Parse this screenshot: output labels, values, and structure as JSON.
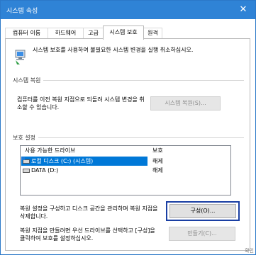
{
  "window": {
    "title": "시스템 속성",
    "close_glyph": "✕"
  },
  "tabs": [
    {
      "label": "컴퓨터 이름",
      "active": false
    },
    {
      "label": "하드웨어",
      "active": false
    },
    {
      "label": "고급",
      "active": false
    },
    {
      "label": "시스템 보호",
      "active": true
    },
    {
      "label": "원격",
      "active": false
    }
  ],
  "intro": {
    "icon": "system-protection-shield-icon",
    "text": "시스템 보호를 사용하여 불필요한 시스템 변경을 실행 취소하십시오."
  },
  "restore": {
    "section_label": "시스템 복원",
    "description": "컴퓨터를 이전 복원 지점으로 되돌려 시스템 변경을 취소할 수 있습니다.",
    "button_label": "시스템 복원(S)..."
  },
  "protection": {
    "section_label": "보호 설정",
    "columns": [
      "사용 가능한 드라이브",
      "보호"
    ],
    "drives": [
      {
        "name": "로컬 디스크 (C:) (시스템)",
        "protection": "해제",
        "selected": true,
        "icon": "system-drive-icon"
      },
      {
        "name": "DATA (D:)",
        "protection": "해제",
        "selected": false,
        "icon": "drive-icon"
      }
    ],
    "configure_text": "복원 설정을 구성하고 디스크 공간을 관리하며 복원 지점을 삭제합니다.",
    "configure_button": "구성(O)...",
    "create_text": "복원 지점을 만들려면 우선 드라이브를 선택하고 [구성]을 클릭하여 보호를 설정하십시오.",
    "create_button": "만들기(C)..."
  },
  "footer_partial": "확인"
}
